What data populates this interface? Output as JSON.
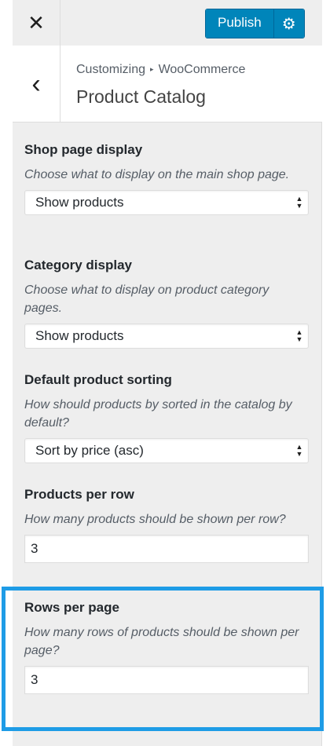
{
  "header": {
    "close_glyph": "✕",
    "publish_label": "Publish",
    "settings_icon": "gear-icon"
  },
  "titlebar": {
    "back_glyph": "‹",
    "breadcrumb_parent": "Customizing",
    "breadcrumb_child": "WooCommerce",
    "section_title": "Product Catalog"
  },
  "controls": [
    {
      "title": "Shop page display",
      "desc": "Choose what to display on the main shop page.",
      "value": "Show products"
    },
    {
      "title": "Category display",
      "desc": "Choose what to display on product category pages.",
      "value": "Show products"
    },
    {
      "title": "Default product sorting",
      "desc": "How should products by sorted in the catalog by default?",
      "value": "Sort by price (asc)"
    },
    {
      "title": "Products per row",
      "desc": "How many products should be shown per row?",
      "value": "3"
    },
    {
      "title": "Rows per page",
      "desc": "How many rows of products should be shown per page?",
      "value": "3"
    }
  ],
  "colors": {
    "accent": "#0085ba",
    "highlight": "#1e9ce6",
    "panel_bg": "#eeeeee"
  }
}
